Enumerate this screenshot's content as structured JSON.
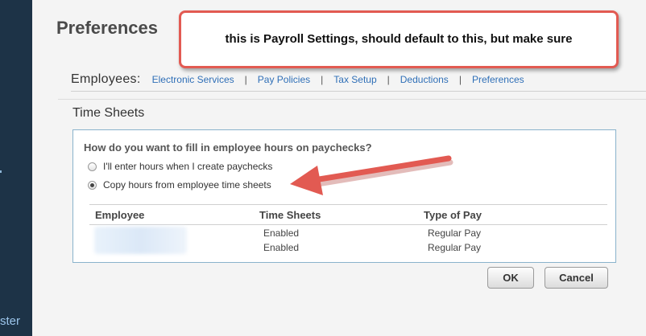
{
  "sidebar": {
    "label": "ster"
  },
  "page": {
    "title": "Preferences"
  },
  "callout": {
    "text": "this is Payroll Settings, should default to this, but make sure"
  },
  "employees_bar": {
    "label": "Employees:",
    "links": [
      "Electronic Services",
      "Pay Policies",
      "Tax Setup",
      "Deductions",
      "Preferences"
    ],
    "separator": "|"
  },
  "time_sheets": {
    "title": "Time Sheets",
    "question": "How do you want to fill in employee hours on paychecks?",
    "options": [
      {
        "label": "I'll enter hours when I create paychecks",
        "checked": false
      },
      {
        "label": "Copy hours from employee time sheets",
        "checked": true
      }
    ],
    "table": {
      "headers": [
        "Employee",
        "Time Sheets",
        "Type of Pay"
      ],
      "rows": [
        {
          "employee": "",
          "time_sheets": "Enabled",
          "type_of_pay": "Regular Pay"
        },
        {
          "employee": "",
          "time_sheets": "Enabled",
          "type_of_pay": "Regular Pay"
        }
      ]
    }
  },
  "buttons": {
    "ok": "OK",
    "cancel": "Cancel"
  },
  "colors": {
    "sidebar": "#1d3347",
    "link": "#2f6fb7",
    "annotation": "#e25a52",
    "panel_border": "#8ab3cc"
  }
}
